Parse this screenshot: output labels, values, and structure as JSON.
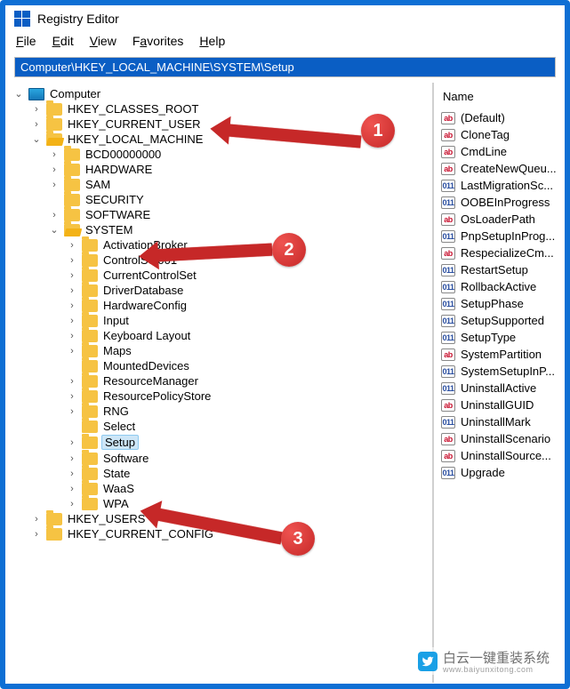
{
  "window": {
    "title": "Registry Editor"
  },
  "menu": {
    "file": {
      "label": "File",
      "accel": "F"
    },
    "edit": {
      "label": "Edit",
      "accel": "E"
    },
    "view": {
      "label": "View",
      "accel": "V"
    },
    "fav": {
      "label": "Favorites",
      "accel": "a"
    },
    "help": {
      "label": "Help",
      "accel": "H"
    }
  },
  "address": "Computer\\HKEY_LOCAL_MACHINE\\SYSTEM\\Setup",
  "tree": {
    "root": "Computer",
    "hives": [
      {
        "name": "HKEY_CLASSES_ROOT",
        "expanded": false
      },
      {
        "name": "HKEY_CURRENT_USER",
        "expanded": false
      },
      {
        "name": "HKEY_LOCAL_MACHINE",
        "expanded": true,
        "children": [
          {
            "name": "BCD00000000",
            "expandable": true
          },
          {
            "name": "HARDWARE",
            "expandable": true
          },
          {
            "name": "SAM",
            "expandable": true
          },
          {
            "name": "SECURITY",
            "expandable": false
          },
          {
            "name": "SOFTWARE",
            "expandable": true
          },
          {
            "name": "SYSTEM",
            "expandable": true,
            "expanded": true,
            "children": [
              {
                "name": "ActivationBroker",
                "expandable": true
              },
              {
                "name": "ControlSet001",
                "expandable": true
              },
              {
                "name": "CurrentControlSet",
                "expandable": true
              },
              {
                "name": "DriverDatabase",
                "expandable": true
              },
              {
                "name": "HardwareConfig",
                "expandable": true
              },
              {
                "name": "Input",
                "expandable": true
              },
              {
                "name": "Keyboard Layout",
                "expandable": true
              },
              {
                "name": "Maps",
                "expandable": true
              },
              {
                "name": "MountedDevices",
                "expandable": false
              },
              {
                "name": "ResourceManager",
                "expandable": true
              },
              {
                "name": "ResourcePolicyStore",
                "expandable": true
              },
              {
                "name": "RNG",
                "expandable": true
              },
              {
                "name": "Select",
                "expandable": false
              },
              {
                "name": "Setup",
                "expandable": true,
                "selected": true
              },
              {
                "name": "Software",
                "expandable": true
              },
              {
                "name": "State",
                "expandable": true
              },
              {
                "name": "WaaS",
                "expandable": true
              },
              {
                "name": "WPA",
                "expandable": true
              }
            ]
          }
        ]
      },
      {
        "name": "HKEY_USERS",
        "expanded": false
      },
      {
        "name": "HKEY_CURRENT_CONFIG",
        "expanded": false
      }
    ]
  },
  "right": {
    "col": "Name",
    "values": [
      {
        "t": "str",
        "name": "(Default)"
      },
      {
        "t": "str",
        "name": "CloneTag"
      },
      {
        "t": "str",
        "name": "CmdLine"
      },
      {
        "t": "str",
        "name": "CreateNewQueu..."
      },
      {
        "t": "bin",
        "name": "LastMigrationSc..."
      },
      {
        "t": "bin",
        "name": "OOBEInProgress"
      },
      {
        "t": "str",
        "name": "OsLoaderPath"
      },
      {
        "t": "bin",
        "name": "PnpSetupInProg..."
      },
      {
        "t": "str",
        "name": "RespecializeCm..."
      },
      {
        "t": "bin",
        "name": "RestartSetup"
      },
      {
        "t": "bin",
        "name": "RollbackActive"
      },
      {
        "t": "bin",
        "name": "SetupPhase"
      },
      {
        "t": "bin",
        "name": "SetupSupported"
      },
      {
        "t": "bin",
        "name": "SetupType"
      },
      {
        "t": "str",
        "name": "SystemPartition"
      },
      {
        "t": "bin",
        "name": "SystemSetupInP..."
      },
      {
        "t": "bin",
        "name": "UninstallActive"
      },
      {
        "t": "str",
        "name": "UninstallGUID"
      },
      {
        "t": "bin",
        "name": "UninstallMark"
      },
      {
        "t": "str",
        "name": "UninstallScenario"
      },
      {
        "t": "str",
        "name": "UninstallSource..."
      },
      {
        "t": "bin",
        "name": "Upgrade"
      }
    ]
  },
  "annotations": {
    "n1": "1",
    "n2": "2",
    "n3": "3"
  },
  "watermark": {
    "main": "白云一键重装系统",
    "sub": "www.baiyunxitong.com"
  }
}
